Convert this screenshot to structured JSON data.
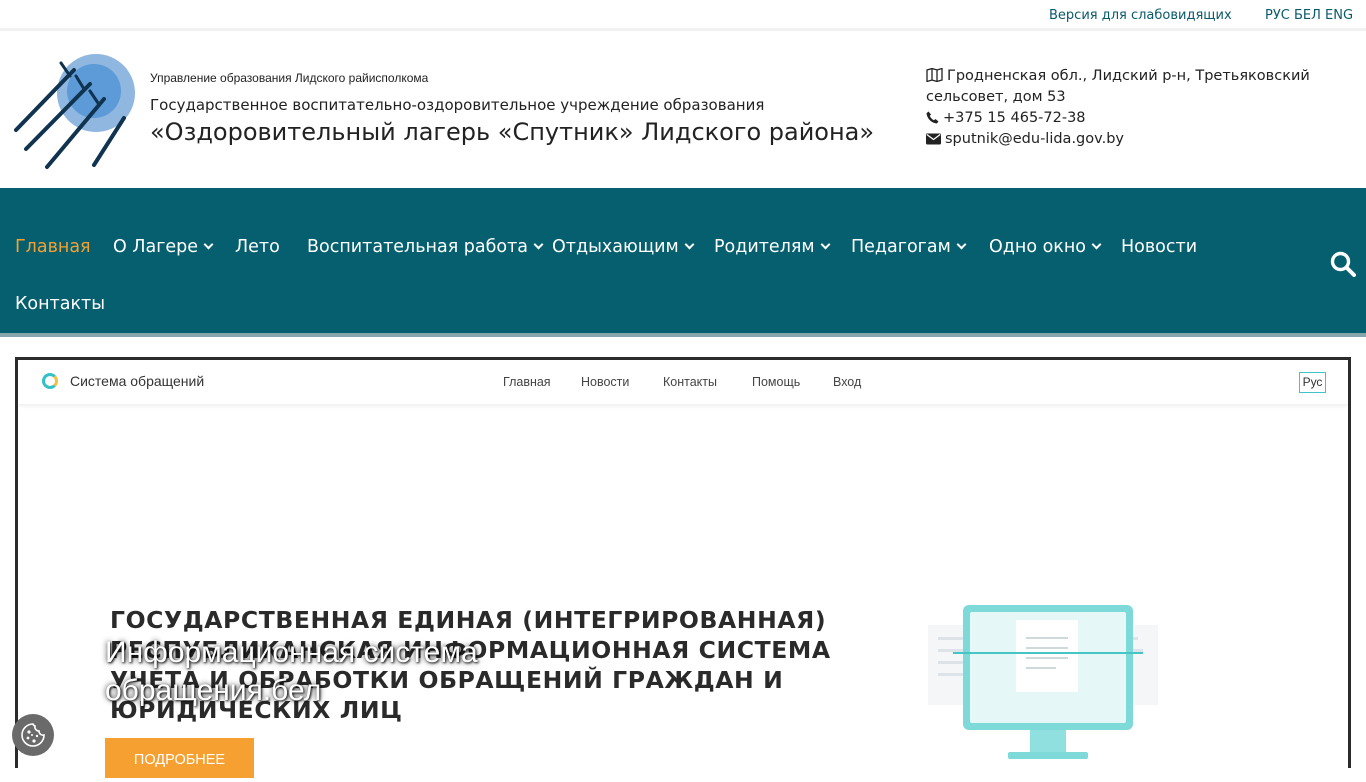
{
  "topbar": {
    "vision_link": "Версия для слабовидящих",
    "languages": "РУС БЕЛ ENG"
  },
  "header": {
    "org_parent": "Управление образования Лидского райисполкома",
    "org_type": "Государственное воспитательно-оздоровительное учреждение образования",
    "org_name": "«Оздоровительный лагерь «Спутник» Лидского района»",
    "address": "Гродненская обл., Лидский р-н, Третьяковский сельсовет, дом 53",
    "phone": "+375 15 465-72-38",
    "email": "sputnik@edu-lida.gov.by"
  },
  "nav": {
    "items": [
      {
        "label": "Главная",
        "active": true
      },
      {
        "label": "О Лагере"
      },
      {
        "label": "Лето"
      },
      {
        "label": "Воспитательная работа"
      },
      {
        "label": "Отдыхающим"
      },
      {
        "label": "Родителям"
      },
      {
        "label": "Педагогам"
      },
      {
        "label": "Одно окно"
      },
      {
        "label": "Новости"
      },
      {
        "label": "Контакты"
      }
    ]
  },
  "slide": {
    "screenshot": {
      "brand": "Система обращений",
      "links": [
        "Главная",
        "Новости",
        "Контакты",
        "Помощь",
        "Вход"
      ],
      "lang": "Рус",
      "headline": [
        "Государственная единая (интегрированная)",
        "республиканская информационная система",
        "учета и обработки обращений граждан и",
        "юридических лиц"
      ]
    },
    "caption_line1": "Информационная система",
    "caption_line2": "обращения.бел",
    "button": "ПОДРОБНЕЕ"
  },
  "colors": {
    "nav_bg": "#055f6e",
    "accent": "#f5a030",
    "link": "#0a5a6b"
  }
}
